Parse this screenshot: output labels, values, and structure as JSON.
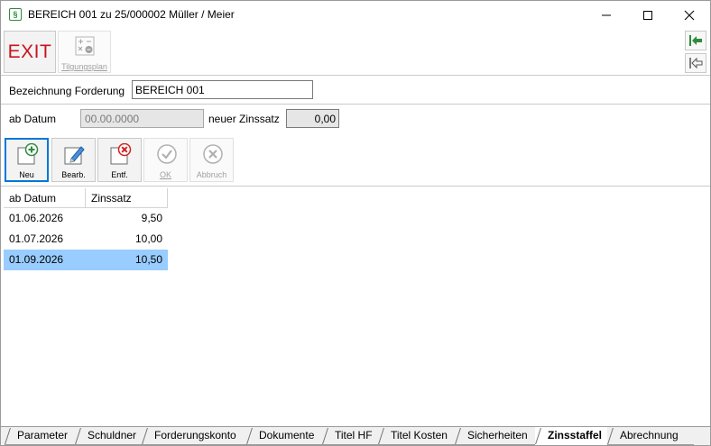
{
  "window": {
    "title": "BEREICH 001 zu 25/000002 Müller / Meier",
    "app_icon": "paragraph-icon"
  },
  "toolbar": {
    "exit_label": "EXIT",
    "tilgungsplan_label": "Tilgungsplan"
  },
  "form": {
    "bezeichnung_label": "Bezeichnung Forderung",
    "bezeichnung_value": "BEREICH 001",
    "ab_datum_label": "ab Datum",
    "ab_datum_value": "00.00.0000",
    "neuer_zinssatz_label": "neuer Zinssatz",
    "neuer_zinssatz_value": "0,00"
  },
  "actions": {
    "neu": "Neu",
    "bearb": "Bearb.",
    "entf": "Entf.",
    "ok": "OK",
    "abbruch": "Abbruch"
  },
  "table": {
    "columns": [
      "ab Datum",
      "Zinssatz"
    ],
    "rows": [
      {
        "datum": "01.06.2026",
        "zinssatz": "9,50"
      },
      {
        "datum": "01.07.2026",
        "zinssatz": "10,00"
      },
      {
        "datum": "01.09.2026",
        "zinssatz": "10,50"
      }
    ],
    "selected_index": 2
  },
  "tabs": [
    {
      "label": "Parameter",
      "active": false
    },
    {
      "label": "Schuldner",
      "active": false
    },
    {
      "label": "Forderungskonto",
      "active": false
    },
    {
      "label": "Dokumente",
      "active": false
    },
    {
      "label": "Titel HF",
      "active": false
    },
    {
      "label": "Titel Kosten",
      "active": false
    },
    {
      "label": "Sicherheiten",
      "active": false
    },
    {
      "label": "Zinsstaffel",
      "active": true
    },
    {
      "label": "Abrechnung",
      "active": false
    }
  ],
  "colors": {
    "exit_red": "#c8141e",
    "selection_blue": "#99ccff",
    "focus_blue": "#0078d7",
    "add_green": "#2f8a3e",
    "delete_red": "#d02020"
  }
}
